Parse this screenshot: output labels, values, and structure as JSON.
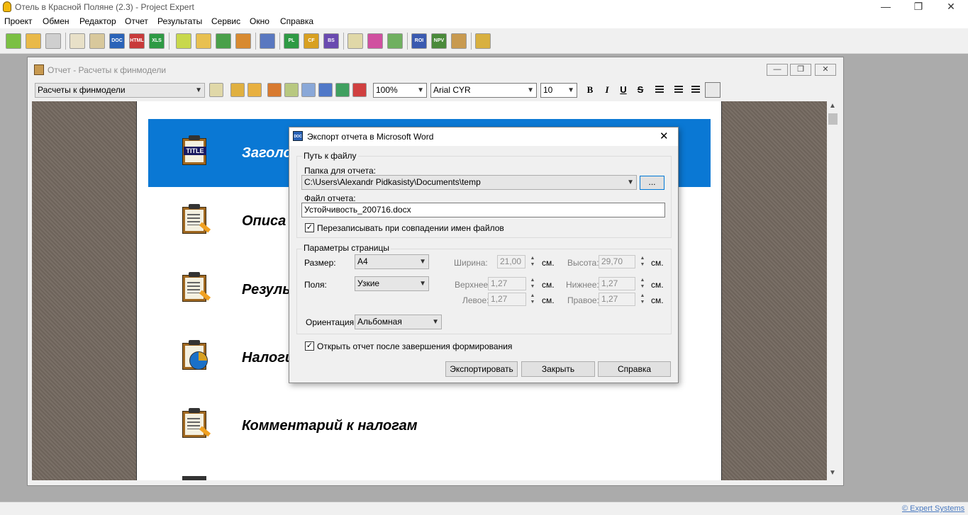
{
  "app": {
    "title": "Отель в Красной Поляне (2.3) - Project Expert",
    "minimize_glyph": "—",
    "maximize_glyph": "❐",
    "close_glyph": "✕"
  },
  "menu": [
    "Проект",
    "Обмен",
    "Редактор",
    "Отчет",
    "Результаты",
    "Сервис",
    "Окно",
    "Справка"
  ],
  "toolbar": {
    "labels": [
      "DOC",
      "HTML",
      "XLS",
      "PL",
      "CF",
      "BS",
      "ROI",
      "NPV"
    ]
  },
  "report_window": {
    "title": "Отчет - Расчеты к финмодели",
    "report_select": "Расчеты к финмодели",
    "zoom": "100%",
    "font": "Arial CYR",
    "font_size": "10",
    "bold": "B",
    "italic": "I",
    "underline": "U",
    "strike": "S",
    "minimize_glyph": "—",
    "restore_glyph": "❐",
    "close_glyph": "✕"
  },
  "page": {
    "sections": [
      "Заголо",
      "Описа",
      "Резуль",
      "Налоги",
      "Комментарий к налогам"
    ],
    "title_icon_text": "TITLE"
  },
  "dialog": {
    "title": "Экспорт отчета в Microsoft Word",
    "icon_label": "DOC",
    "file_group": "Путь к файлу",
    "folder_label": "Папка для отчета:",
    "folder_value": "C:\\Users\\Alexandr Pidkasisty\\Documents\\temp",
    "browse_button": "...",
    "file_label": "Файл отчета:",
    "file_value": "Устойчивость_200716.docx",
    "overwrite_label": "Перезаписывать при совпадении имен файлов",
    "page_group": "Параметры страницы",
    "size_label": "Размер:",
    "size_value": "A4",
    "margins_label": "Поля:",
    "margins_value": "Узкие",
    "width_label": "Ширина:",
    "width_value": "21,00",
    "height_label": "Высота:",
    "height_value": "29,70",
    "top_label": "Верхнее:",
    "top_value": "1,27",
    "bottom_label": "Нижнее:",
    "bottom_value": "1,27",
    "left_label": "Левое:",
    "left_value": "1,27",
    "right_label": "Правое:",
    "right_value": "1,27",
    "unit": "см.",
    "orientation_label": "Ориентация:",
    "orientation_value": "Альбомная",
    "open_after_label": "Открыть отчет после завершения формирования",
    "export_button": "Экспортировать",
    "close_button": "Закрыть",
    "help_button": "Справка",
    "close_glyph": "✕"
  },
  "status": {
    "copyright": "© Expert Systems"
  },
  "colors": {
    "accent_blue": "#0a78d4",
    "canvas_brown": "#73685f"
  }
}
